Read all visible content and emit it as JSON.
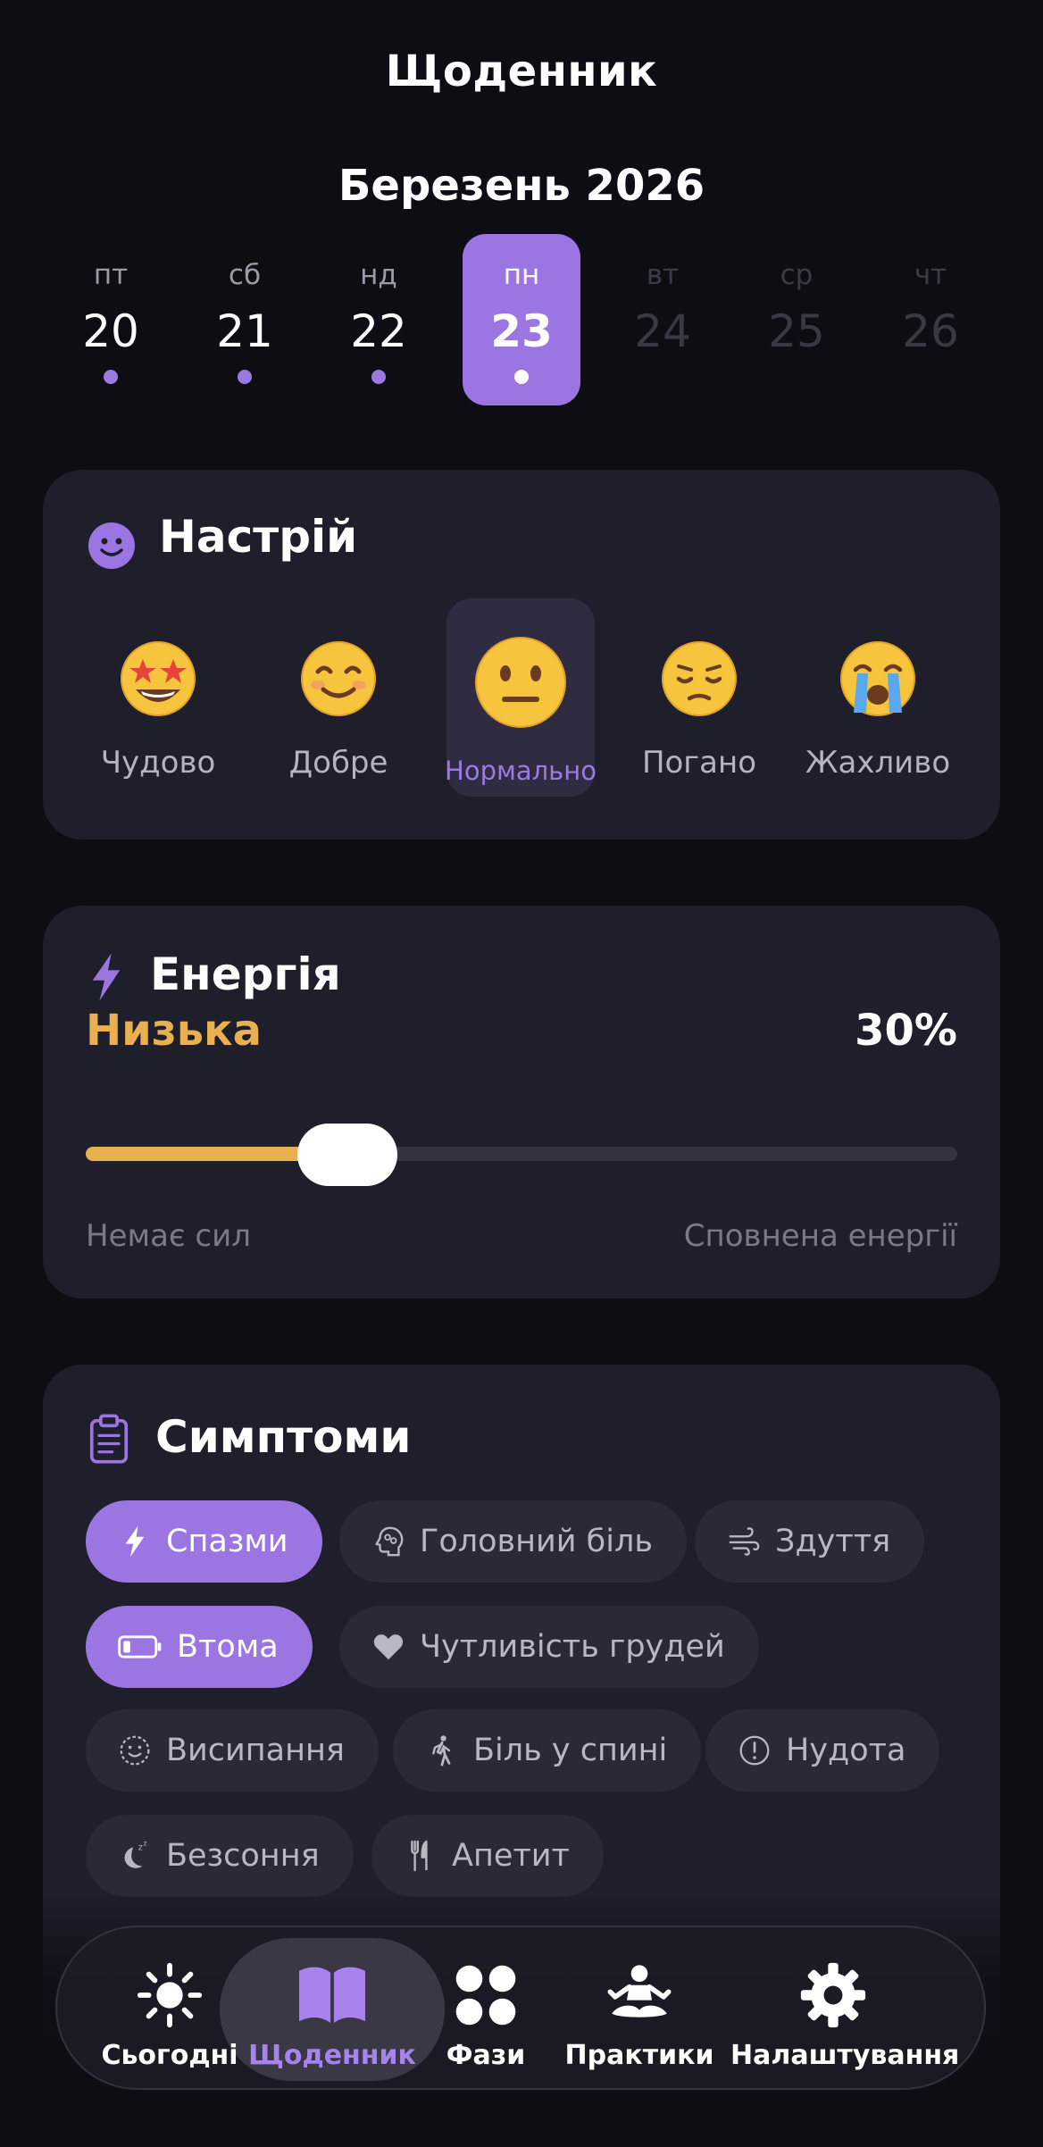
{
  "header": {
    "title": "Щоденник",
    "month": "Березень 2026"
  },
  "week": [
    {
      "name": "пт",
      "num": "20",
      "dot": true,
      "state": "past"
    },
    {
      "name": "сб",
      "num": "21",
      "dot": true,
      "state": "past"
    },
    {
      "name": "нд",
      "num": "22",
      "dot": true,
      "state": "past"
    },
    {
      "name": "пн",
      "num": "23",
      "dot": true,
      "state": "selected"
    },
    {
      "name": "вт",
      "num": "24",
      "dot": false,
      "state": "future"
    },
    {
      "name": "ср",
      "num": "25",
      "dot": false,
      "state": "future"
    },
    {
      "name": "чт",
      "num": "26",
      "dot": false,
      "state": "future"
    }
  ],
  "mood": {
    "title": "Настрій",
    "selected": "Нормально",
    "options": [
      {
        "label": "Чудово",
        "icon": "star-struck-emoji"
      },
      {
        "label": "Добре",
        "icon": "smiling-emoji"
      },
      {
        "label": "Нормально",
        "icon": "neutral-face-emoji"
      },
      {
        "label": "Погано",
        "icon": "pensive-emoji"
      },
      {
        "label": "Жахливо",
        "icon": "crying-emoji"
      }
    ]
  },
  "energy": {
    "title": "Енергія",
    "level": "Низька",
    "percent_text": "30%",
    "value": 0.3,
    "min_label": "Немає сил",
    "max_label": "Сповнена енергії"
  },
  "symptoms": {
    "title": "Симптоми",
    "chips": [
      {
        "label": "Спазми",
        "icon": "bolt-icon",
        "selected": true
      },
      {
        "label": "Головний біль",
        "icon": "brain-icon",
        "selected": false
      },
      {
        "label": "Здуття",
        "icon": "wind-icon",
        "selected": false
      },
      {
        "label": "Втома",
        "icon": "battery-low-icon",
        "selected": true
      },
      {
        "label": "Чутливість грудей",
        "icon": "heart-icon",
        "selected": false
      },
      {
        "label": "Висипання",
        "icon": "dotted-face-icon",
        "selected": false
      },
      {
        "label": "Біль у спині",
        "icon": "walking-icon",
        "selected": false
      },
      {
        "label": "Нудота",
        "icon": "exclamation-circle-icon",
        "selected": false
      },
      {
        "label": "Безсоння",
        "icon": "moon-zzz-icon",
        "selected": false
      },
      {
        "label": "Апетит",
        "icon": "fork-knife-icon",
        "selected": false
      }
    ]
  },
  "tabbar": {
    "tabs": [
      {
        "label": "Сьогодні",
        "icon": "sun-icon"
      },
      {
        "label": "Щоденник",
        "icon": "book-icon",
        "selected": true
      },
      {
        "label": "Фази",
        "icon": "four-circles-icon"
      },
      {
        "label": "Практики",
        "icon": "meditation-icon"
      },
      {
        "label": "Налаштування",
        "icon": "gear-icon"
      }
    ]
  },
  "colors": {
    "background": "#0e0d14",
    "card": "#1f1e2b",
    "accent": "#9b76e3",
    "energy": "#e9b04f"
  }
}
